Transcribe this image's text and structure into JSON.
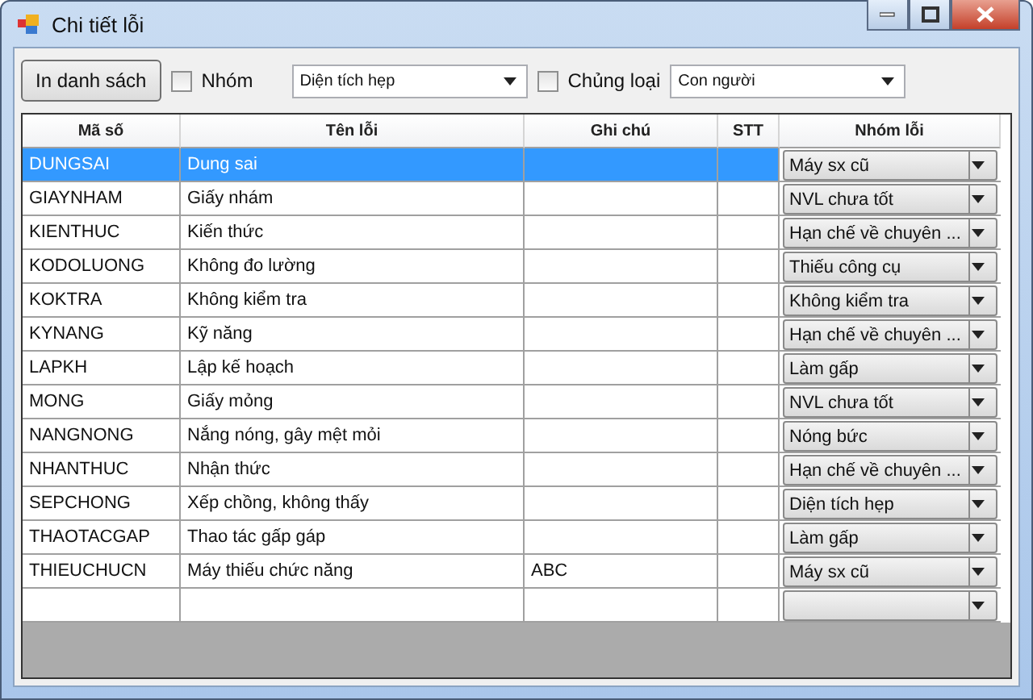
{
  "window": {
    "title": "Chi tiết lỗi"
  },
  "toolbar": {
    "print_button": "In danh sách",
    "group_filter": {
      "label": "Nhóm",
      "checked": false,
      "value": "Diện tích hẹp"
    },
    "type_filter": {
      "label": "Chủng loại",
      "checked": false,
      "value": "Con người"
    }
  },
  "table": {
    "columns": [
      "Mã số",
      "Tên lỗi",
      "Ghi chú",
      "STT",
      "Nhóm lỗi"
    ],
    "rows": [
      {
        "code": "DUNGSAI",
        "name": "Dung sai",
        "note": "",
        "order": "",
        "group": "Máy sx cũ",
        "selected": true
      },
      {
        "code": "GIAYNHAM",
        "name": "Giấy nhám",
        "note": "",
        "order": "",
        "group": "NVL chưa tốt",
        "selected": false
      },
      {
        "code": "KIENTHUC",
        "name": "Kiến thức",
        "note": "",
        "order": "",
        "group": "Hạn chế về chuyên ...",
        "selected": false
      },
      {
        "code": "KODOLUONG",
        "name": "Không đo lường",
        "note": "",
        "order": "",
        "group": "Thiếu công cụ",
        "selected": false
      },
      {
        "code": "KOKTRA",
        "name": "Không kiểm tra",
        "note": "",
        "order": "",
        "group": "Không kiểm tra",
        "selected": false
      },
      {
        "code": "KYNANG",
        "name": "Kỹ năng",
        "note": "",
        "order": "",
        "group": "Hạn chế về chuyên ...",
        "selected": false
      },
      {
        "code": "LAPKH",
        "name": "Lập kế hoạch",
        "note": "",
        "order": "",
        "group": "Làm gấp",
        "selected": false
      },
      {
        "code": "MONG",
        "name": "Giấy mỏng",
        "note": "",
        "order": "",
        "group": "NVL chưa tốt",
        "selected": false
      },
      {
        "code": "NANGNONG",
        "name": "Nắng nóng, gây mệt mỏi",
        "note": "",
        "order": "",
        "group": "Nóng bức",
        "selected": false
      },
      {
        "code": "NHANTHUC",
        "name": "Nhận thức",
        "note": "",
        "order": "",
        "group": "Hạn chế về chuyên ...",
        "selected": false
      },
      {
        "code": "SEPCHONG",
        "name": "Xếp chồng, không thấy",
        "note": "",
        "order": "",
        "group": "Diện tích hẹp",
        "selected": false
      },
      {
        "code": "THAOTACGAP",
        "name": "Thao tác gấp gáp",
        "note": "",
        "order": "",
        "group": "Làm gấp",
        "selected": false
      },
      {
        "code": "THIEUCHUCN",
        "name": "Máy thiếu chức năng",
        "note": "ABC",
        "order": "",
        "group": "Máy sx cũ",
        "selected": false
      },
      {
        "code": "",
        "name": "",
        "note": "",
        "order": "",
        "group": "",
        "selected": false
      }
    ]
  }
}
